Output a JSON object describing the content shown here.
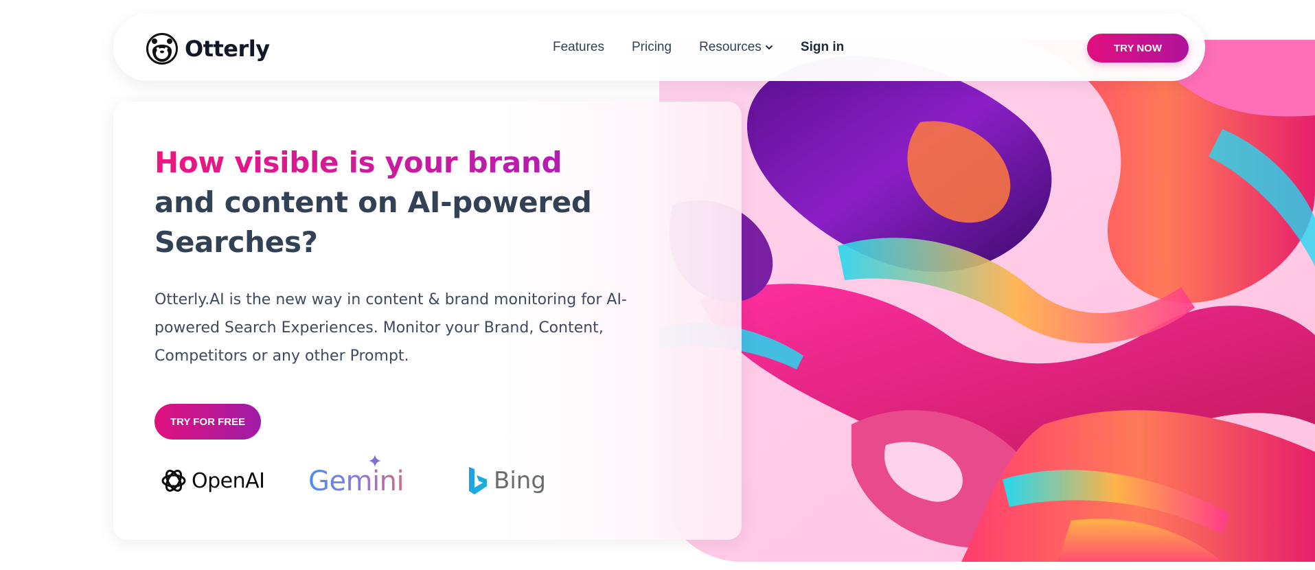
{
  "brand": {
    "name": "Otterly",
    "logo_icon": "otter-icon"
  },
  "nav": {
    "links": [
      {
        "label": "Features"
      },
      {
        "label": "Pricing"
      },
      {
        "label": "Resources",
        "icon": "chevron-down-icon"
      },
      {
        "label": "Sign in"
      }
    ],
    "cta": "TRY NOW"
  },
  "hero": {
    "headline_accent": "How visible is your brand",
    "headline_rest": "and content on AI-powered Searches?",
    "subtext": "Otterly.AI is the new way in content & brand monitoring for AI-powered Search Experiences. Monitor your Brand, Content, Competitors or any other Prompt.",
    "cta": "TRY FOR FREE"
  },
  "partner_logos": [
    {
      "name": "OpenAI",
      "icon": "openai-icon"
    },
    {
      "name": "Gemini",
      "icon": "gemini-star-icon"
    },
    {
      "name": "Bing",
      "icon": "bing-icon"
    }
  ],
  "colors": {
    "accent_pink": "#e0107f",
    "accent_purple": "#a721b8",
    "text_dark": "#334155"
  }
}
